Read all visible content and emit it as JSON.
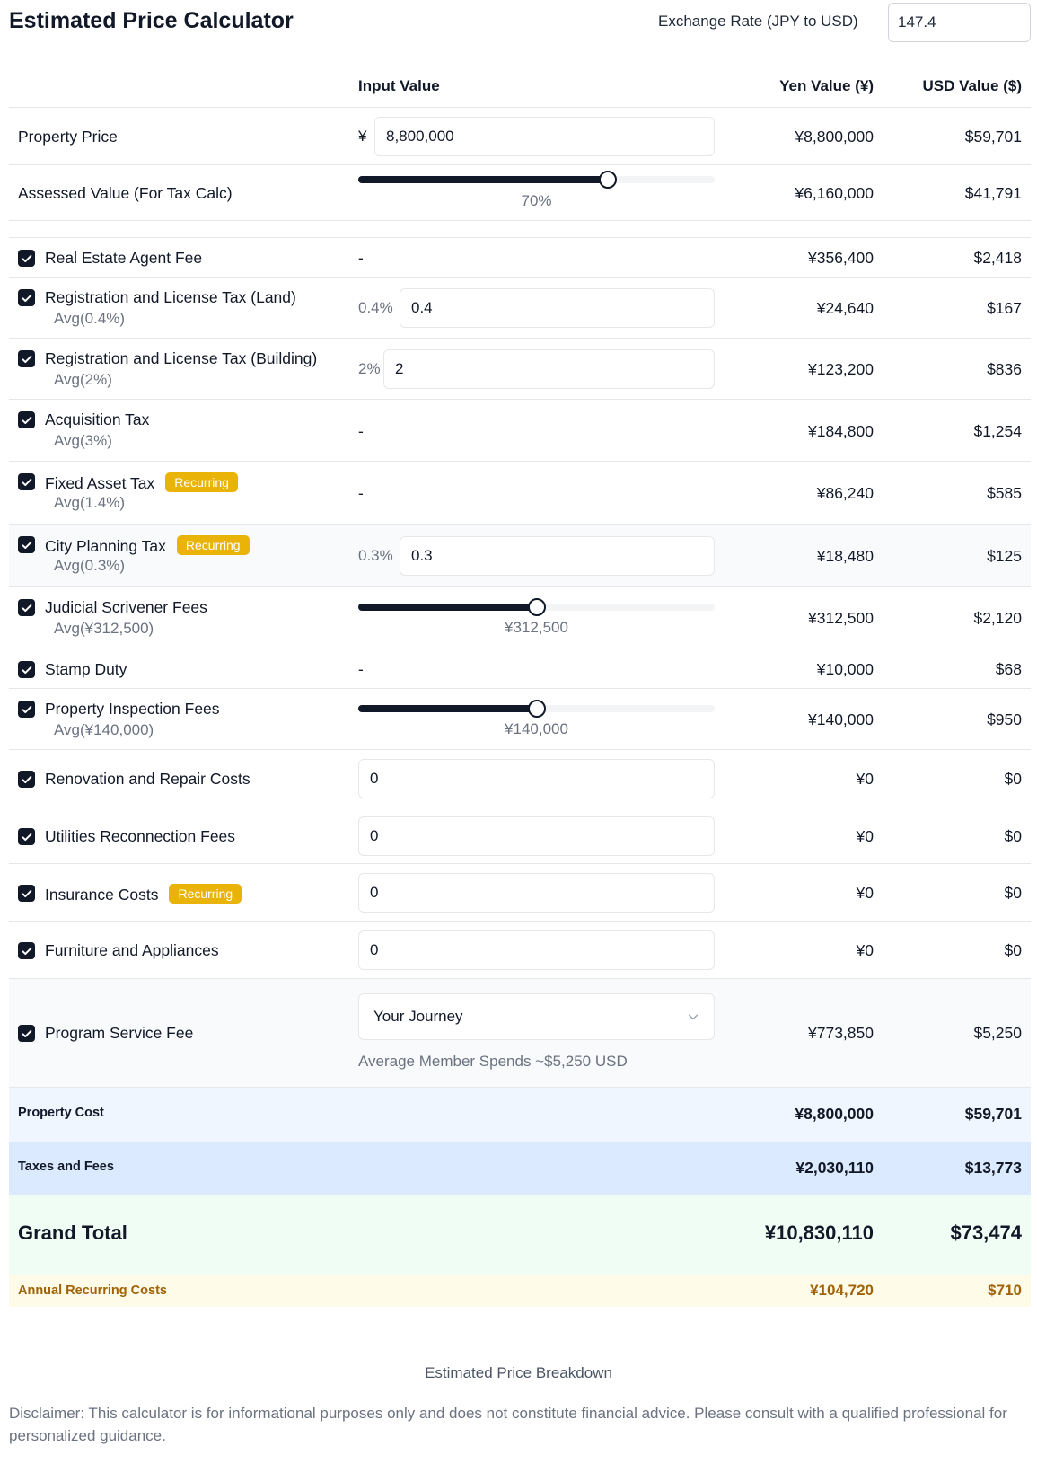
{
  "app": {
    "title": "Estimated Price Calculator"
  },
  "exchange": {
    "label": "Exchange Rate (JPY to USD)",
    "value": "147.4"
  },
  "headers": {
    "input": "Input Value",
    "yen": "Yen Value (¥)",
    "usd": "USD Value ($)"
  },
  "property": {
    "label": "Property Price",
    "prefix": "¥",
    "value": "8,800,000",
    "yen": "¥8,800,000",
    "usd": "$59,701"
  },
  "assessed": {
    "label": "Assessed Value (For Tax Calc)",
    "percent_label": "70%",
    "percent": 0.7,
    "yen": "¥6,160,000",
    "usd": "$41,791"
  },
  "recurring_badge": "Recurring",
  "fees": [
    {
      "label": "Real Estate Agent Fee",
      "avg": "",
      "input": "-",
      "yen": "¥356,400",
      "usd": "$2,418",
      "checked": true
    },
    {
      "label": "Registration and License Tax (Land)",
      "avg": "Avg(0.4%)",
      "pct": "0.4%",
      "value": "0.4",
      "yen": "¥24,640",
      "usd": "$167",
      "checked": true
    },
    {
      "label": "Registration and License Tax (Building)",
      "avg": "Avg(2%)",
      "pct": "2%",
      "value": "2",
      "yen": "¥123,200",
      "usd": "$836",
      "checked": true
    },
    {
      "label": "Acquisition Tax",
      "avg": "Avg(3%)",
      "input": "-",
      "yen": "¥184,800",
      "usd": "$1,254",
      "checked": true
    },
    {
      "label": "Fixed Asset Tax",
      "avg": "Avg(1.4%)",
      "input": "-",
      "yen": "¥86,240",
      "usd": "$585",
      "checked": true,
      "recurring": true
    },
    {
      "label": "City Planning Tax",
      "avg": "Avg(0.3%)",
      "pct": "0.3%",
      "value": "0.3",
      "yen": "¥18,480",
      "usd": "$125",
      "checked": true,
      "recurring": true
    },
    {
      "label": "Judicial Scrivener Fees",
      "avg": "Avg(¥312,500)",
      "slider_label": "¥312,500",
      "slider": 0.5,
      "yen": "¥312,500",
      "usd": "$2,120",
      "checked": true
    },
    {
      "label": "Stamp Duty",
      "avg": "",
      "input": "-",
      "yen": "¥10,000",
      "usd": "$68",
      "checked": true
    },
    {
      "label": "Property Inspection Fees",
      "avg": "Avg(¥140,000)",
      "slider_label": "¥140,000",
      "slider": 0.5,
      "yen": "¥140,000",
      "usd": "$950",
      "checked": true
    },
    {
      "label": "Renovation and Repair Costs",
      "value": "0",
      "yen": "¥0",
      "usd": "$0",
      "checked": true
    },
    {
      "label": "Utilities Reconnection Fees",
      "value": "0",
      "yen": "¥0",
      "usd": "$0",
      "checked": true
    },
    {
      "label": "Insurance Costs",
      "value": "0",
      "yen": "¥0",
      "usd": "$0",
      "checked": true,
      "recurring": true
    },
    {
      "label": "Furniture and Appliances",
      "value": "0",
      "yen": "¥0",
      "usd": "$0",
      "checked": true
    }
  ],
  "program": {
    "label": "Program Service Fee",
    "select_value": "Your Journey",
    "note": "Average Member Spends ~$5,250 USD",
    "yen": "¥773,850",
    "usd": "$5,250"
  },
  "summary": {
    "property_cost": {
      "label": "Property Cost",
      "yen": "¥8,800,000",
      "usd": "$59,701"
    },
    "taxes_fees": {
      "label": "Taxes and Fees",
      "yen": "¥2,030,110",
      "usd": "$13,773"
    },
    "grand_total": {
      "label": "Grand Total",
      "yen": "¥10,830,110",
      "usd": "$73,474"
    },
    "annual_recurring": {
      "label": "Annual Recurring Costs",
      "yen": "¥104,720",
      "usd": "$710"
    }
  },
  "footer": {
    "caption": "Estimated Price Breakdown",
    "disclaimer": "Disclaimer: This calculator is for informational purposes only and does not constitute financial advice. Please consult with a qualified professional for personalized guidance."
  },
  "colors": {
    "accent": "#111827",
    "badge": "#eab308",
    "row_highlight": "#f9fafb",
    "property_bg": "#eff6ff",
    "taxes_bg": "#dbeafe",
    "total_bg": "#f0fdf4",
    "recurring_bg": "#fefce8",
    "recurring_text": "#a16207"
  }
}
